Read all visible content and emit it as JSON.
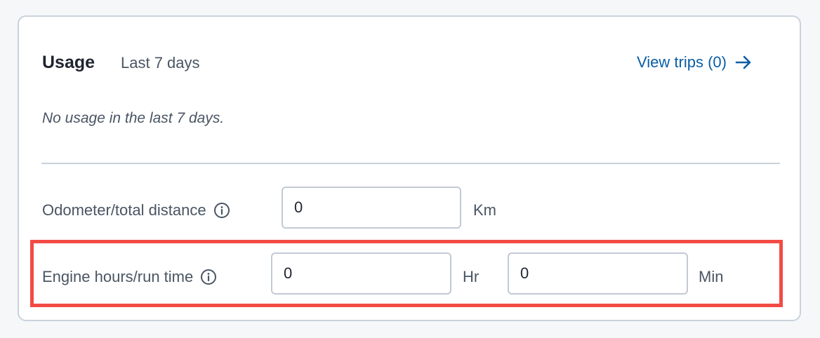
{
  "usage": {
    "title": "Usage",
    "period": "Last 7 days",
    "view_trips_label": "View trips (0)",
    "empty_message": "No usage in the last 7 days."
  },
  "odometer": {
    "label": "Odometer/total distance",
    "value": "0",
    "unit": "Km"
  },
  "engine": {
    "label": "Engine hours/run time",
    "hours_value": "0",
    "hours_unit": "Hr",
    "minutes_value": "0",
    "minutes_unit": "Min"
  },
  "colors": {
    "link": "#0a5ea5",
    "highlight": "#f24b45",
    "border": "#c9d2dc"
  },
  "icons": [
    "arrow-right-icon",
    "info-icon"
  ]
}
